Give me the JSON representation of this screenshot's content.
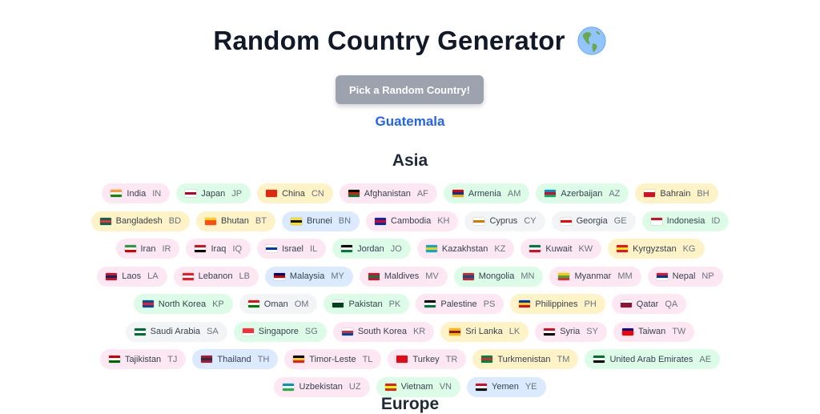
{
  "header": {
    "title": "Random Country Generator",
    "icon": "globe-americas-icon"
  },
  "button": {
    "label": "Pick a Random Country!"
  },
  "result": {
    "country": "Guatemala"
  },
  "regions": [
    {
      "name": "Asia",
      "countries": [
        {
          "name": "India",
          "code": "IN",
          "bg": "#fce7f3",
          "flag": [
            "#ff9933",
            "#ffffff",
            "#138808"
          ]
        },
        {
          "name": "Japan",
          "code": "JP",
          "bg": "#dcfce7",
          "flag": [
            "#ffffff",
            "#bc002d",
            "#ffffff"
          ]
        },
        {
          "name": "China",
          "code": "CN",
          "bg": "#fef3c7",
          "flag": [
            "#de2910",
            "#de2910",
            "#de2910"
          ]
        },
        {
          "name": "Afghanistan",
          "code": "AF",
          "bg": "#fce7f3",
          "flag": [
            "#000000",
            "#d32011",
            "#007a36"
          ]
        },
        {
          "name": "Armenia",
          "code": "AM",
          "bg": "#dcfce7",
          "flag": [
            "#d90012",
            "#0033a0",
            "#f2a800"
          ]
        },
        {
          "name": "Azerbaijan",
          "code": "AZ",
          "bg": "#dcfce7",
          "flag": [
            "#0092bc",
            "#e4002b",
            "#00af66"
          ]
        },
        {
          "name": "Bahrain",
          "code": "BH",
          "bg": "#fef3c7",
          "flag": [
            "#ffffff",
            "#ce1126",
            "#ce1126"
          ]
        },
        {
          "name": "Bangladesh",
          "code": "BD",
          "bg": "#fef3c7",
          "flag": [
            "#006a4e",
            "#f42a41",
            "#006a4e"
          ]
        },
        {
          "name": "Bhutan",
          "code": "BT",
          "bg": "#fef3c7",
          "flag": [
            "#ffd520",
            "#ff4e12",
            "#ff4e12"
          ]
        },
        {
          "name": "Brunei",
          "code": "BN",
          "bg": "#dbeafe",
          "flag": [
            "#f7e017",
            "#111111",
            "#f7e017"
          ]
        },
        {
          "name": "Cambodia",
          "code": "KH",
          "bg": "#fce7f3",
          "flag": [
            "#032ea1",
            "#e00025",
            "#032ea1"
          ]
        },
        {
          "name": "Cyprus",
          "code": "CY",
          "bg": "#f3f4f6",
          "flag": [
            "#ffffff",
            "#d57800",
            "#ffffff"
          ]
        },
        {
          "name": "Georgia",
          "code": "GE",
          "bg": "#f3f4f6",
          "flag": [
            "#ffffff",
            "#ff0000",
            "#ffffff"
          ]
        },
        {
          "name": "Indonesia",
          "code": "ID",
          "bg": "#dcfce7",
          "flag": [
            "#ce1126",
            "#ffffff",
            "#ffffff"
          ]
        },
        {
          "name": "Iran",
          "code": "IR",
          "bg": "#fce7f3",
          "flag": [
            "#239f40",
            "#ffffff",
            "#da0000"
          ]
        },
        {
          "name": "Iraq",
          "code": "IQ",
          "bg": "#fce7f3",
          "flag": [
            "#ce1126",
            "#ffffff",
            "#000000"
          ]
        },
        {
          "name": "Israel",
          "code": "IL",
          "bg": "#fce7f3",
          "flag": [
            "#ffffff",
            "#0038b8",
            "#ffffff"
          ]
        },
        {
          "name": "Jordan",
          "code": "JO",
          "bg": "#dcfce7",
          "flag": [
            "#000000",
            "#ffffff",
            "#007a3d"
          ]
        },
        {
          "name": "Kazakhstan",
          "code": "KZ",
          "bg": "#fce7f3",
          "flag": [
            "#00afca",
            "#fec50c",
            "#00afca"
          ]
        },
        {
          "name": "Kuwait",
          "code": "KW",
          "bg": "#fce7f3",
          "flag": [
            "#007a3d",
            "#ffffff",
            "#ce1126"
          ]
        },
        {
          "name": "Kyrgyzstan",
          "code": "KG",
          "bg": "#fef3c7",
          "flag": [
            "#e8112d",
            "#ffef00",
            "#e8112d"
          ]
        },
        {
          "name": "Laos",
          "code": "LA",
          "bg": "#fce7f3",
          "flag": [
            "#ce1126",
            "#002868",
            "#ce1126"
          ]
        },
        {
          "name": "Lebanon",
          "code": "LB",
          "bg": "#fce7f3",
          "flag": [
            "#ed1c24",
            "#ffffff",
            "#ed1c24"
          ]
        },
        {
          "name": "Malaysia",
          "code": "MY",
          "bg": "#dbeafe",
          "flag": [
            "#010066",
            "#cc0001",
            "#ffffff"
          ]
        },
        {
          "name": "Maldives",
          "code": "MV",
          "bg": "#fce7f3",
          "flag": [
            "#d21034",
            "#007e3a",
            "#d21034"
          ]
        },
        {
          "name": "Mongolia",
          "code": "MN",
          "bg": "#dcfce7",
          "flag": [
            "#c4272f",
            "#015197",
            "#c4272f"
          ]
        },
        {
          "name": "Myanmar",
          "code": "MM",
          "bg": "#fce7f3",
          "flag": [
            "#fecb00",
            "#34b233",
            "#ea2839"
          ]
        },
        {
          "name": "Nepal",
          "code": "NP",
          "bg": "#fce7f3",
          "flag": [
            "#dc143c",
            "#003893",
            "#ffffff"
          ]
        },
        {
          "name": "North Korea",
          "code": "KP",
          "bg": "#dcfce7",
          "flag": [
            "#024fa2",
            "#ed1c27",
            "#024fa2"
          ]
        },
        {
          "name": "Oman",
          "code": "OM",
          "bg": "#f3f4f6",
          "flag": [
            "#db161b",
            "#ffffff",
            "#008000"
          ]
        },
        {
          "name": "Pakistan",
          "code": "PK",
          "bg": "#dcfce7",
          "flag": [
            "#ffffff",
            "#01411c",
            "#01411c"
          ]
        },
        {
          "name": "Palestine",
          "code": "PS",
          "bg": "#fce7f3",
          "flag": [
            "#000000",
            "#ffffff",
            "#007a3d"
          ]
        },
        {
          "name": "Philippines",
          "code": "PH",
          "bg": "#fef3c7",
          "flag": [
            "#0038a8",
            "#fcd116",
            "#ce1126"
          ]
        },
        {
          "name": "Qatar",
          "code": "QA",
          "bg": "#fce7f3",
          "flag": [
            "#ffffff",
            "#8a1538",
            "#8a1538"
          ]
        },
        {
          "name": "Saudi Arabia",
          "code": "SA",
          "bg": "#f3f4f6",
          "flag": [
            "#006c35",
            "#ffffff",
            "#006c35"
          ]
        },
        {
          "name": "Singapore",
          "code": "SG",
          "bg": "#dcfce7",
          "flag": [
            "#ef3340",
            "#ef3340",
            "#ffffff"
          ]
        },
        {
          "name": "South Korea",
          "code": "KR",
          "bg": "#fce7f3",
          "flag": [
            "#ffffff",
            "#cd2e3a",
            "#0047a0"
          ]
        },
        {
          "name": "Sri Lanka",
          "code": "LK",
          "bg": "#fef3c7",
          "flag": [
            "#ffb700",
            "#8d153a",
            "#ffb700"
          ]
        },
        {
          "name": "Syria",
          "code": "SY",
          "bg": "#fce7f3",
          "flag": [
            "#ce1126",
            "#ffffff",
            "#000000"
          ]
        },
        {
          "name": "Taiwan",
          "code": "TW",
          "bg": "#fce7f3",
          "flag": [
            "#000095",
            "#fe0000",
            "#fe0000"
          ]
        },
        {
          "name": "Tajikistan",
          "code": "TJ",
          "bg": "#fce7f3",
          "flag": [
            "#cc0000",
            "#ffffff",
            "#006600"
          ]
        },
        {
          "name": "Thailand",
          "code": "TH",
          "bg": "#dbeafe",
          "flag": [
            "#a51931",
            "#2d2a4a",
            "#a51931"
          ]
        },
        {
          "name": "Timor-Leste",
          "code": "TL",
          "bg": "#fce7f3",
          "flag": [
            "#000000",
            "#ffc726",
            "#dc241f"
          ]
        },
        {
          "name": "Turkey",
          "code": "TR",
          "bg": "#fce7f3",
          "flag": [
            "#e30a17",
            "#e30a17",
            "#e30a17"
          ]
        },
        {
          "name": "Turkmenistan",
          "code": "TM",
          "bg": "#fef3c7",
          "flag": [
            "#00843d",
            "#d22630",
            "#00843d"
          ]
        },
        {
          "name": "United Arab Emirates",
          "code": "AE",
          "bg": "#dcfce7",
          "flag": [
            "#00732f",
            "#ffffff",
            "#000000"
          ]
        },
        {
          "name": "Uzbekistan",
          "code": "UZ",
          "bg": "#fce7f3",
          "flag": [
            "#0099b5",
            "#ffffff",
            "#1eb53a"
          ]
        },
        {
          "name": "Vietnam",
          "code": "VN",
          "bg": "#dcfce7",
          "flag": [
            "#da251d",
            "#ffff00",
            "#da251d"
          ]
        },
        {
          "name": "Yemen",
          "code": "YE",
          "bg": "#dbeafe",
          "flag": [
            "#ce1126",
            "#ffffff",
            "#000000"
          ]
        }
      ]
    },
    {
      "name": "Europe",
      "countries": []
    }
  ]
}
